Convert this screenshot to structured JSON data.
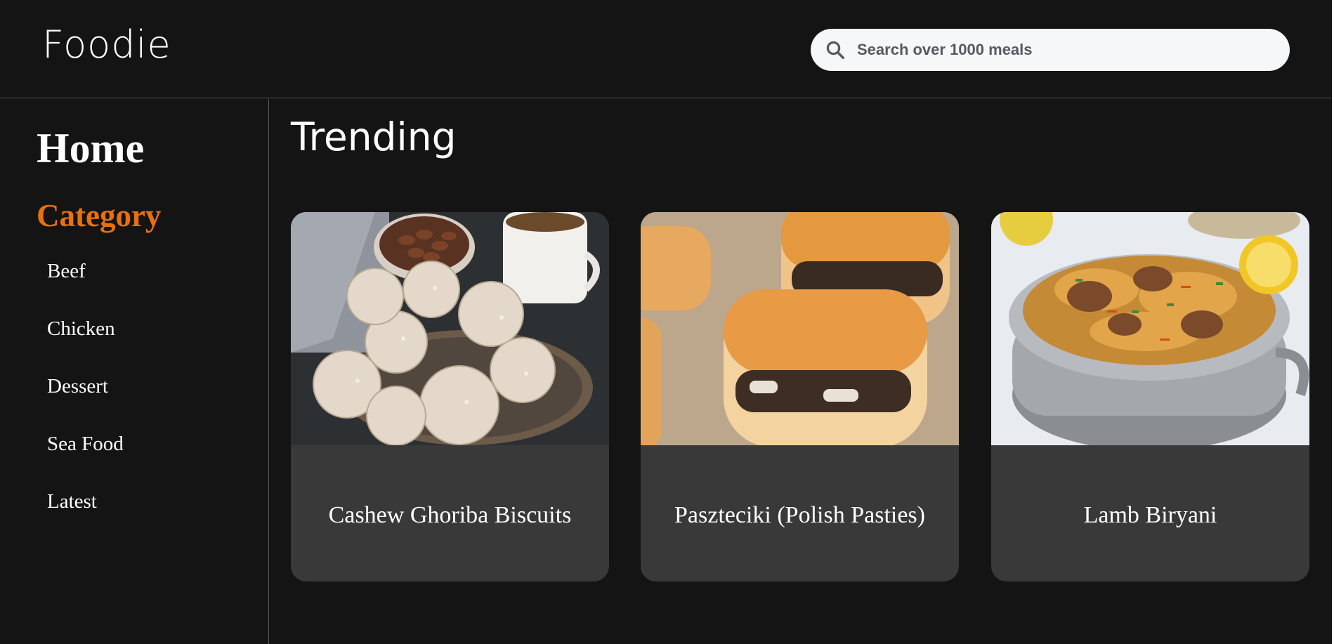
{
  "header": {
    "logo": "Foodie",
    "search_placeholder": "Search over 1000 meals",
    "search_value": ""
  },
  "sidebar": {
    "home_label": "Home",
    "category_label": "Category",
    "categories": [
      "Beef",
      "Chicken",
      "Dessert",
      "Sea Food",
      "Latest"
    ]
  },
  "main": {
    "section_title": "Trending",
    "cards": [
      {
        "title": "Cashew Ghoriba Biscuits"
      },
      {
        "title": "Paszteciki (Polish Pasties)"
      },
      {
        "title": "Lamb Biryani"
      }
    ]
  },
  "colors": {
    "background": "#141414",
    "accent": "#e8710e",
    "card": "#3a393a",
    "divider": "#5a5a5a"
  }
}
